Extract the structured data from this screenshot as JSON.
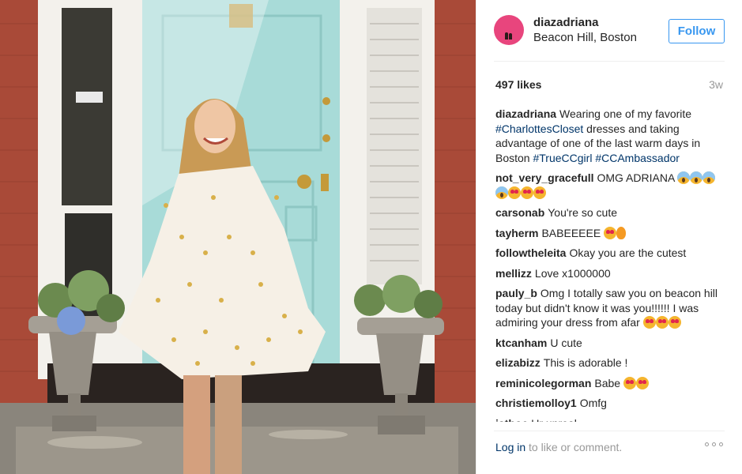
{
  "post": {
    "username": "diazadriana",
    "location": "Beacon Hill, Boston",
    "follow_label": "Follow",
    "likes": "497 likes",
    "time_ago": "3w"
  },
  "caption": {
    "user": "diazadriana",
    "text_1": "Wearing one of my favorite",
    "tag_1": "#CharlottesCloset",
    "text_2": "dresses and taking advantage of one of the last warm days in Boston",
    "tag_2": "#TrueCCgirl",
    "tag_3": "#CCAmbassador"
  },
  "comments": [
    {
      "user": "not_very_gracefull",
      "text": "OMG ADRIANA",
      "emoji": [
        "scream",
        "scream",
        "scream",
        "scream",
        "heart-eyes",
        "heart-eyes",
        "heart-eyes"
      ]
    },
    {
      "user": "carsonab",
      "text": "You're so cute",
      "emoji": []
    },
    {
      "user": "tayherm",
      "text": "BABEEEEE",
      "emoji": [
        "heart-eyes",
        "fire"
      ]
    },
    {
      "user": "followtheleita",
      "text": "Okay you are the cutest",
      "emoji": []
    },
    {
      "user": "mellizz",
      "text": "Love x1000000",
      "emoji": []
    },
    {
      "user": "pauly_b",
      "text": "Omg I totally saw you on beacon hill today but didn't know it was you!!!!!! I was admiring your dress from afar",
      "emoji": [
        "heart-eyes",
        "heart-eyes",
        "heart-eyes"
      ]
    },
    {
      "user": "ktcanham",
      "text": "U cute",
      "emoji": []
    },
    {
      "user": "elizabizz",
      "text": "This is adorable !",
      "emoji": []
    },
    {
      "user": "reminicolegorman",
      "text": "Babe",
      "emoji": [
        "heart-eyes",
        "heart-eyes"
      ]
    },
    {
      "user": "christiemolloy1",
      "text": "Omfg",
      "emoji": []
    },
    {
      "user": "iathoe",
      "text": "Ur unreal",
      "emoji": []
    }
  ],
  "footer": {
    "login_label": "Log in",
    "rest": "to like or comment."
  },
  "icons": {
    "more": "more-options-icon"
  },
  "colors": {
    "link": "#003569",
    "follow": "#3897f0",
    "avatar": "#e8457d",
    "door": "#a8dbd8"
  }
}
